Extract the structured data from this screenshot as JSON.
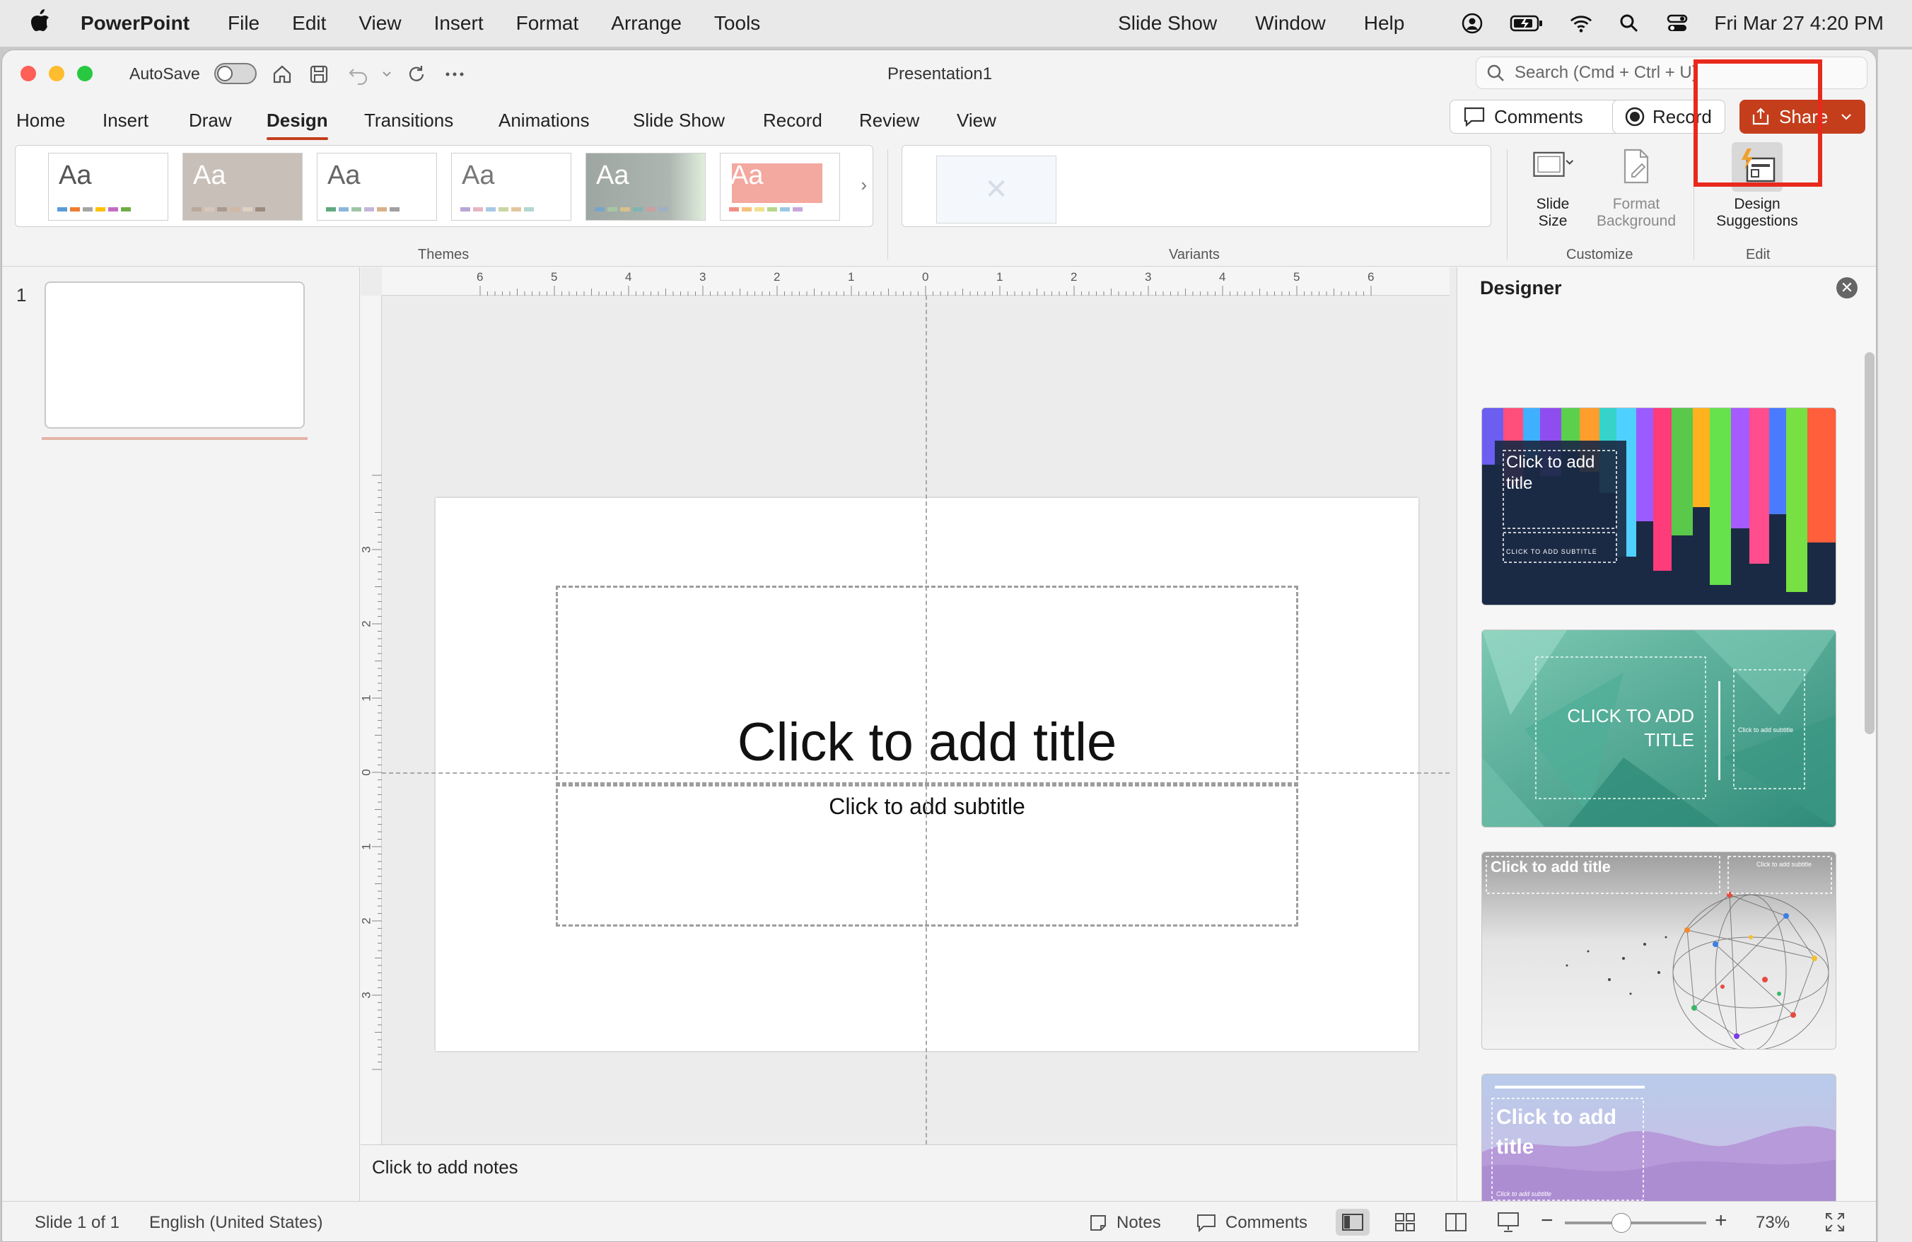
{
  "menubar": {
    "app_name": "PowerPoint",
    "items": [
      "File",
      "Edit",
      "View",
      "Insert",
      "Format",
      "Arrange",
      "Tools"
    ],
    "right_items": [
      "Slide Show",
      "Window",
      "Help"
    ],
    "clock": "Fri Mar 27  4:20 PM"
  },
  "titlebar": {
    "autosave_label": "AutoSave",
    "doc_title": "Presentation1",
    "search_placeholder": "Search (Cmd + Ctrl + U)"
  },
  "tabs": [
    "Home",
    "Insert",
    "Draw",
    "Design",
    "Transitions",
    "Animations",
    "Slide Show",
    "Record",
    "Review",
    "View"
  ],
  "active_tab": "Design",
  "actions": {
    "comments": "Comments",
    "record": "Record",
    "share": "Share"
  },
  "ribbon": {
    "themes_label": "Themes",
    "variants_label": "Variants",
    "customize_label": "Customize",
    "edit_label": "Edit",
    "theme_glyph": "Aa",
    "slide_size": "Slide Size",
    "format_background": "Format Background",
    "design_suggestions": "Design Suggestions"
  },
  "thumbnails": {
    "slide_number": "1"
  },
  "slide": {
    "title_placeholder": "Click to add title",
    "subtitle_placeholder": "Click to add subtitle"
  },
  "ruler": {
    "h_labels": [
      "6",
      "5",
      "4",
      "3",
      "2",
      "1",
      "0",
      "1",
      "2",
      "3",
      "4",
      "5",
      "6"
    ],
    "v_labels": [
      "3",
      "2",
      "1",
      "0",
      "1",
      "2",
      "3"
    ]
  },
  "notes_placeholder": "Click to add notes",
  "designer": {
    "title": "Designer",
    "suggestions": [
      {
        "title": "Click to add title",
        "subtitle": "CLICK TO ADD SUBTITLE"
      },
      {
        "title": "CLICK TO ADD TITLE",
        "subtitle": "Click to add subtitle"
      },
      {
        "title": "Click to add title",
        "subtitle": "Click to add subtitle"
      },
      {
        "title": "Click to add title",
        "subtitle": "Click to add subtitle"
      }
    ]
  },
  "statusbar": {
    "slide_info": "Slide 1 of 1",
    "language": "English (United States)",
    "notes": "Notes",
    "comments": "Comments",
    "zoom": "73%"
  },
  "colors": {
    "accent": "#c43e1c",
    "highlight": "#e8291c"
  }
}
